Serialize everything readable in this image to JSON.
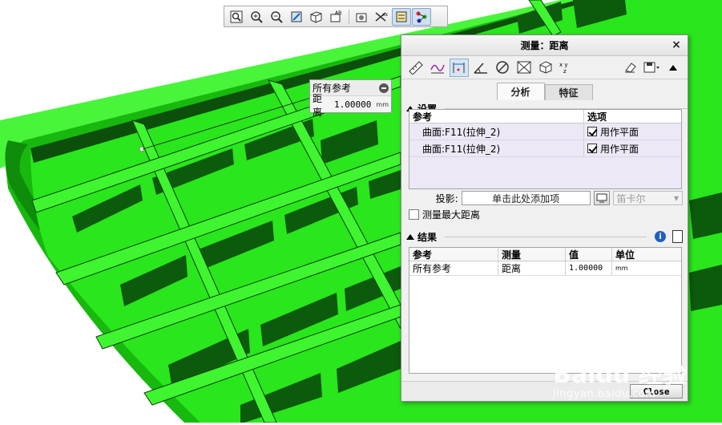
{
  "window": {
    "title": "测量：距离",
    "close_glyph": "×"
  },
  "view_toolbar": {
    "buttons": [
      "zoom-fit-icon",
      "zoom-in-icon",
      "zoom-out-icon",
      "repaint-icon",
      "view-orient-icon",
      "saved-views-icon",
      "display-style-icon",
      "datum-display-icon",
      "annotation-display-icon",
      "spin-center-icon"
    ]
  },
  "readout": {
    "title": "所有参考",
    "label": "距离",
    "value": "1.00000",
    "unit": "mm"
  },
  "dialog_tools": [
    "length-icon",
    "curve-length-icon",
    "distance-icon",
    "angle-icon",
    "diameter-icon",
    "area-icon",
    "volume-icon",
    "transform-icon"
  ],
  "tabs": [
    {
      "label": "分析",
      "active": true
    },
    {
      "label": "特征",
      "active": false
    }
  ],
  "settings": {
    "section_label": "设置",
    "columns": [
      "参考",
      "选项"
    ],
    "rows": [
      {
        "reference": "曲面:F11(拉伸_2)",
        "option": "用作平面",
        "checked": true
      },
      {
        "reference": "曲面:F11(拉伸_2)",
        "option": "用作平面",
        "checked": true
      }
    ],
    "projection_label": "投影:",
    "projection_placeholder": "单击此处添加项",
    "coord_system": "笛卡尔",
    "max_distance_label": "测量最大距离"
  },
  "results": {
    "section_label": "结果",
    "columns": [
      "参考",
      "测量",
      "值",
      "单位"
    ],
    "rows": [
      {
        "reference": "所有参考",
        "measure": "距离",
        "value": "1.00000",
        "unit": "mm"
      }
    ]
  },
  "close_button": "Close",
  "watermark": {
    "brand": "Baidu 经验",
    "url": "jingyan.baidu.com"
  },
  "colors": {
    "model_green": "#27e61a",
    "model_dark": "#0c5a0c",
    "accent_blue": "#1f5fbf"
  }
}
